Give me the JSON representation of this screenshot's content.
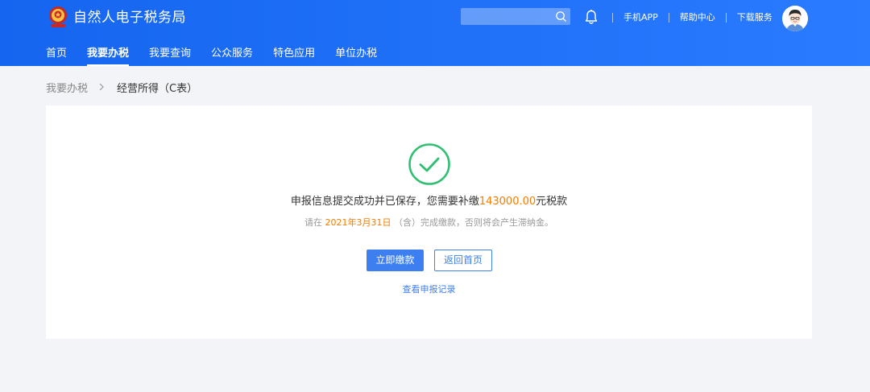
{
  "header": {
    "title": "自然人电子税务局",
    "search": {
      "value": "",
      "placeholder": ""
    },
    "links": [
      "手机APP",
      "帮助中心",
      "下载服务"
    ]
  },
  "nav": {
    "items": [
      "首页",
      "我要办税",
      "我要查询",
      "公众服务",
      "特色应用",
      "单位办税"
    ],
    "active": "我要办税"
  },
  "breadcrumb": {
    "parent": "我要办税",
    "current": "经营所得（C表）"
  },
  "result": {
    "main_prefix": "申报信息提交成功并已保存，您需要补缴",
    "amount": "143000.00",
    "main_suffix": "元税款",
    "sub_prefix": "请在 ",
    "due_date": "2021年3月31日",
    "sub_suffix": " （含）完成缴款，否则将会产生滞纳金。",
    "pay_button": "立即缴款",
    "home_button": "返回首页",
    "records_link": "查看申报记录"
  },
  "icons": {
    "logo": "tax-emblem-icon",
    "search": "search-icon",
    "bell": "bell-icon",
    "breadcrumb_separator": "chevron-right-icon",
    "success": "check-circle-icon",
    "avatar": "user-avatar"
  },
  "colors": {
    "header_blue": "#1a6ef5",
    "primary": "#3d7ff0",
    "success_green": "#2fbf71",
    "highlight_orange": "#f57c00",
    "page_background": "#f3f4f7"
  }
}
